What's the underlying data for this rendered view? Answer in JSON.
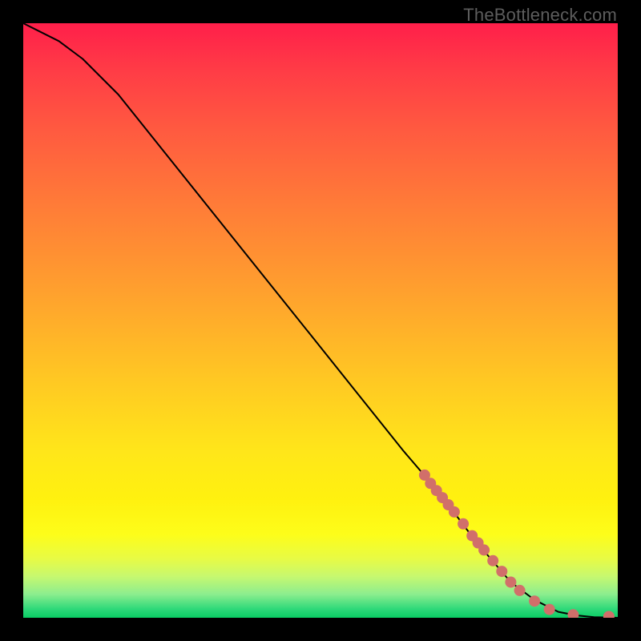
{
  "attribution": "TheBottleneck.com",
  "chart_data": {
    "type": "line",
    "title": "",
    "xlabel": "",
    "ylabel": "",
    "xlim": [
      0,
      100
    ],
    "ylim": [
      0,
      100
    ],
    "grid": false,
    "series": [
      {
        "name": "curve",
        "x": [
          0,
          6,
          10,
          16,
          24,
          32,
          40,
          48,
          56,
          64,
          70,
          76,
          82,
          86,
          90,
          93,
          96,
          100
        ],
        "values": [
          100,
          97,
          94,
          88,
          78,
          68,
          58,
          48,
          38,
          28,
          21,
          13,
          6,
          3,
          1,
          0.4,
          0.1,
          0
        ]
      }
    ],
    "markers": [
      {
        "x": 67.5,
        "y": 24.0
      },
      {
        "x": 68.5,
        "y": 22.6
      },
      {
        "x": 69.5,
        "y": 21.4
      },
      {
        "x": 70.5,
        "y": 20.2
      },
      {
        "x": 71.5,
        "y": 19.0
      },
      {
        "x": 72.5,
        "y": 17.8
      },
      {
        "x": 74.0,
        "y": 15.8
      },
      {
        "x": 75.5,
        "y": 13.8
      },
      {
        "x": 76.5,
        "y": 12.6
      },
      {
        "x": 77.5,
        "y": 11.4
      },
      {
        "x": 79.0,
        "y": 9.6
      },
      {
        "x": 80.5,
        "y": 7.8
      },
      {
        "x": 82.0,
        "y": 6.0
      },
      {
        "x": 83.5,
        "y": 4.6
      },
      {
        "x": 86.0,
        "y": 2.8
      },
      {
        "x": 88.5,
        "y": 1.4
      },
      {
        "x": 92.5,
        "y": 0.5
      },
      {
        "x": 98.5,
        "y": 0.2
      }
    ],
    "marker_color": "#d16f6a",
    "curve_color": "#000000"
  }
}
